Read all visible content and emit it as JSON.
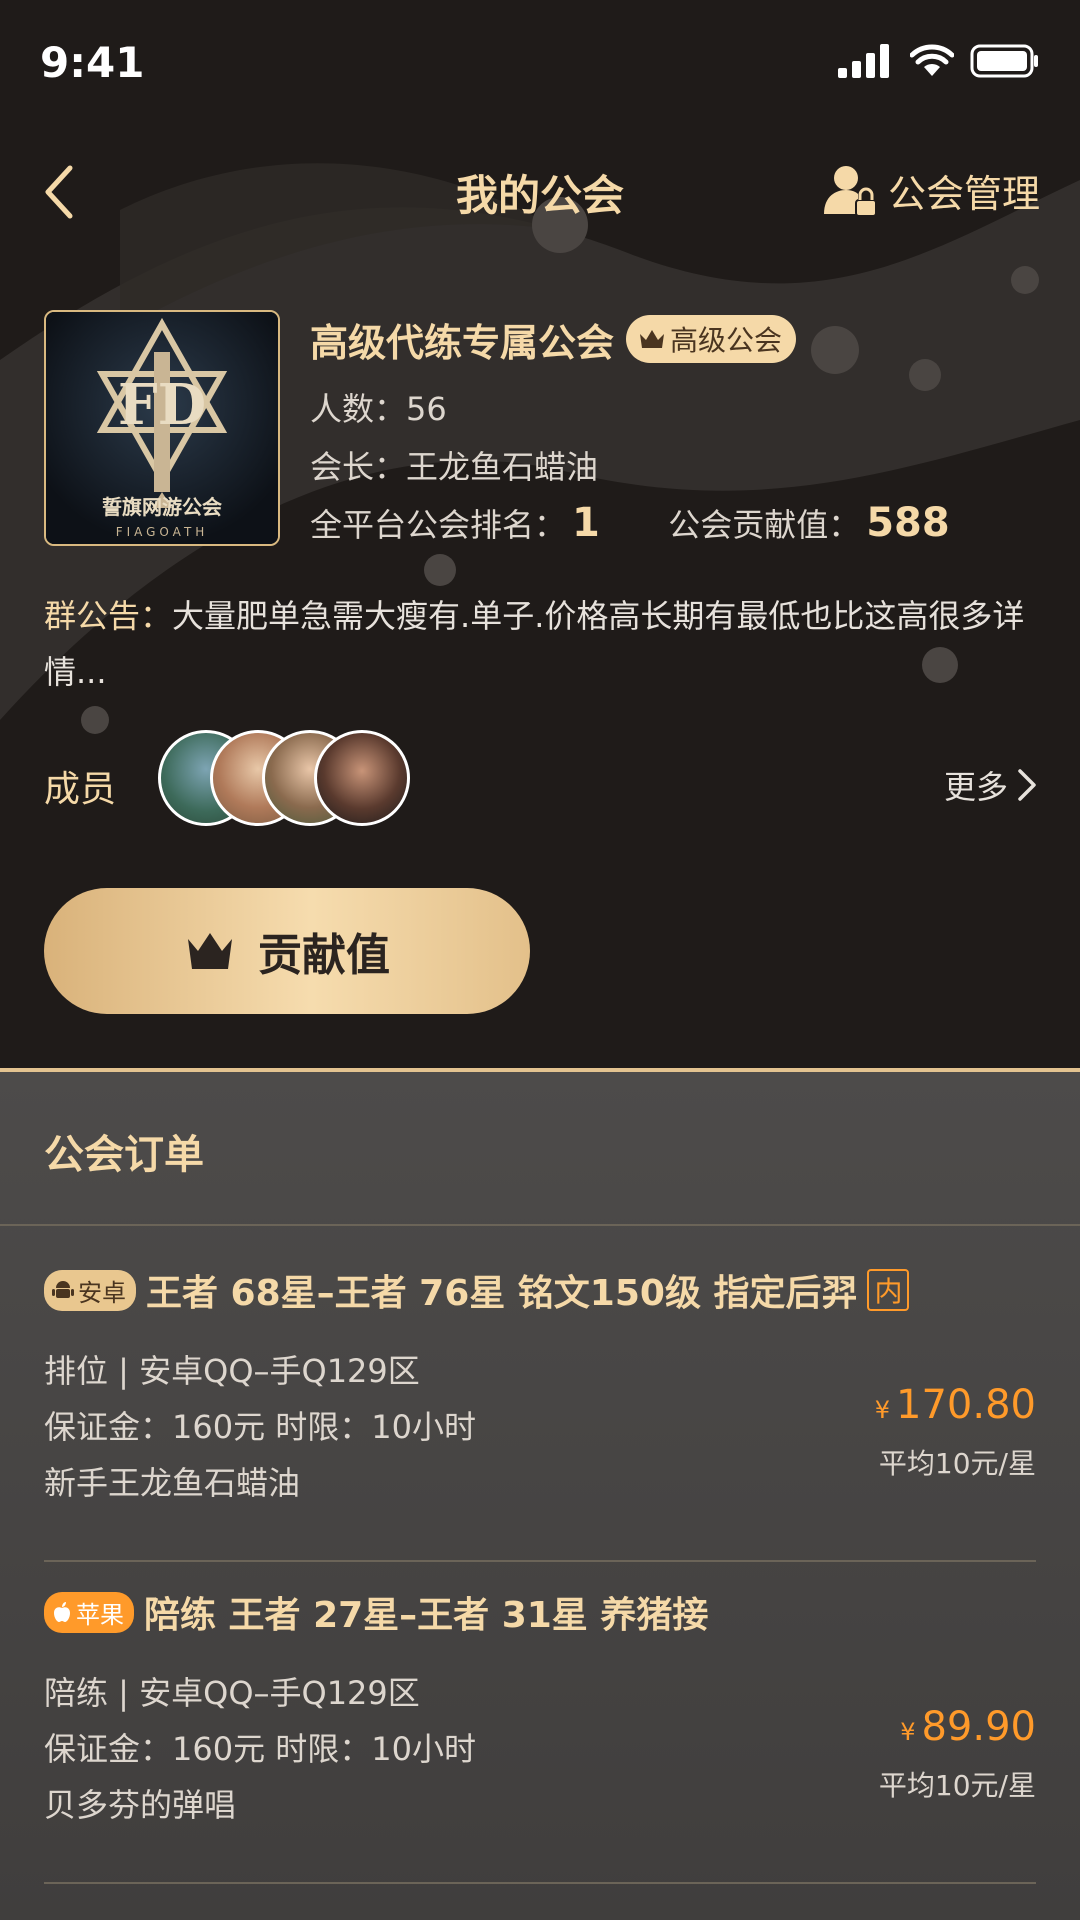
{
  "status": {
    "time": "9:41"
  },
  "nav": {
    "title": "我的公会",
    "manage_label": "公会管理"
  },
  "guild": {
    "logo_text": "誓旗网游公会",
    "logo_subtext": "FIAGOATH",
    "name": "高级代练专属公会",
    "badge": "高级公会",
    "members_label": "人数：",
    "members_count": "56",
    "leader_label": "会长：",
    "leader_name": "王龙鱼石蜡油",
    "rank_label": "全平台公会排名：",
    "rank_value": "1",
    "contrib_label": "公会贡献值：",
    "contrib_value": "588"
  },
  "notice": {
    "label": "群公告：",
    "text": "大量肥单急需大瘦有.单子.价格高长期有最低也比这高很多详情..."
  },
  "members": {
    "label": "成员",
    "more": "更多"
  },
  "contrib_button": {
    "label": "贡献值"
  },
  "orders": {
    "title": "公会订单",
    "items": [
      {
        "platform": "安卓",
        "title": "王者 68星–王者 76星 铭文150级 指定后羿",
        "tag": "内",
        "type_line": "排位 | 安卓QQ–手Q129区",
        "deposit_line": "保证金：160元   时限：10小时",
        "owner": "新手王龙鱼石蜡油",
        "yen": "¥",
        "price": "170.80",
        "avg": "平均10元/星"
      },
      {
        "platform": "苹果",
        "title": "陪练 王者 27星–王者 31星 养猪接",
        "type_line": "陪练 | 安卓QQ–手Q129区",
        "deposit_line": "保证金：160元   时限：10小时",
        "owner": "贝多芬的弹唱",
        "yen": "¥",
        "price": "89.90",
        "avg": "平均10元/星"
      }
    ]
  },
  "colors": {
    "gold": "#f5d9a8",
    "orange": "#ff9a2a",
    "dark_bg": "#1f1b19",
    "list_bg": "#4a4847"
  }
}
